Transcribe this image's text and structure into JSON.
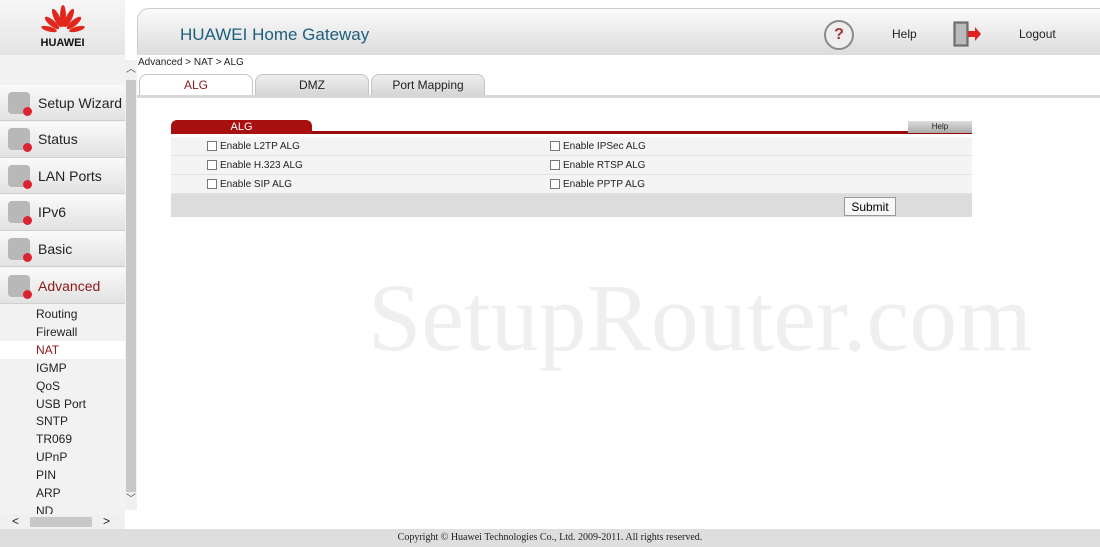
{
  "brand": {
    "logo_text": "HUAWEI",
    "color": "#e1261c"
  },
  "header": {
    "title": "HUAWEI Home Gateway",
    "help": "Help",
    "logout": "Logout",
    "help_icon": "question-icon",
    "logout_icon": "exit-door-icon"
  },
  "breadcrumb": "Advanced > NAT > ALG",
  "tabs": [
    {
      "label": "ALG",
      "active": true
    },
    {
      "label": "DMZ"
    },
    {
      "label": "Port Mapping"
    }
  ],
  "sidebar": {
    "menus": [
      {
        "label": "Setup Wizard"
      },
      {
        "label": "Status"
      },
      {
        "label": "LAN Ports"
      },
      {
        "label": "IPv6"
      },
      {
        "label": "Basic"
      },
      {
        "label": "Advanced",
        "active": true
      }
    ],
    "subitems": [
      "Routing",
      "Firewall",
      "NAT",
      "IGMP",
      "QoS",
      "USB Port",
      "SNTP",
      "TR069",
      "UPnP",
      "PIN",
      "ARP",
      "ND"
    ],
    "active_sub": "NAT"
  },
  "panel": {
    "title": "ALG",
    "help": "Help",
    "options": [
      {
        "label": "Enable L2TP ALG",
        "checked": false
      },
      {
        "label": "Enable IPSec ALG",
        "checked": false
      },
      {
        "label": "Enable H.323 ALG",
        "checked": false
      },
      {
        "label": "Enable RTSP ALG",
        "checked": false
      },
      {
        "label": "Enable SIP ALG",
        "checked": false
      },
      {
        "label": "Enable PPTP ALG",
        "checked": false
      }
    ],
    "submit": "Submit"
  },
  "watermark": "SetupRouter.com",
  "footer": "Copyright © Huawei Technologies Co., Ltd. 2009-2011. All rights reserved.",
  "colors": {
    "accent": "#a8100f",
    "title": "#1d5e7e",
    "active_text": "#8b1a1a"
  }
}
